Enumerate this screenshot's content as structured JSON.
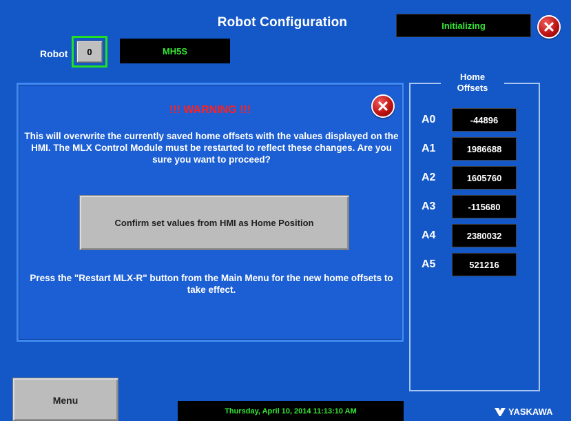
{
  "header": {
    "title": "Robot Configuration",
    "status": "Initializing"
  },
  "robot": {
    "label": "Robot",
    "number": "0",
    "model": "MH5S"
  },
  "warning": {
    "title": "!!! WARNING !!!",
    "message": "This will overwrite the currently saved home offsets with the values displayed on the HMI. The MLX Control Module must be restarted to reflect these changes.  Are you sure you want to proceed?",
    "confirm_label": "Confirm set values from HMI as Home Position",
    "restart_note": "Press the \"Restart MLX-R\" button from the Main Menu for the new home offsets to take effect."
  },
  "home_offsets": {
    "title_line1": "Home",
    "title_line2": "Offsets",
    "axes": [
      {
        "label": "A0",
        "value": "-44896"
      },
      {
        "label": "A1",
        "value": "1986688"
      },
      {
        "label": "A2",
        "value": "1605760"
      },
      {
        "label": "A3",
        "value": "-115680"
      },
      {
        "label": "A4",
        "value": "2380032"
      },
      {
        "label": "A5",
        "value": "521216"
      }
    ]
  },
  "footer": {
    "menu_label": "Menu",
    "datetime": "Thursday, April 10, 2014 11:13:10 AM",
    "logo": "YASKAWA"
  },
  "colors": {
    "background": "#1458c8",
    "status_green": "#36e836",
    "warning_red": "#ff2020"
  },
  "icons": {
    "close": "close-icon",
    "warning_close": "close-icon",
    "logo_mark": "yaskawa-logo-icon"
  }
}
